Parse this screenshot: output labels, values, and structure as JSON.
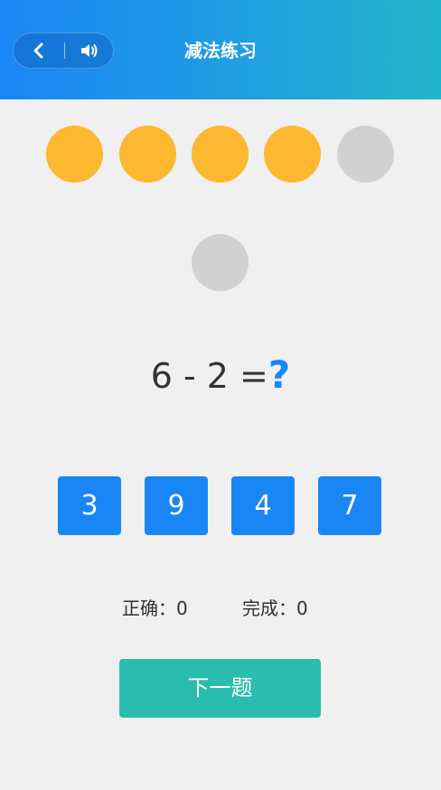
{
  "header": {
    "title": "减法练习",
    "back_icon": "chevron-left-icon",
    "sound_icon": "speaker-icon",
    "gradient": [
      "#1a86f5",
      "#22b5c9"
    ]
  },
  "visual": {
    "dots_total": 5,
    "dots_filled": 4,
    "filled_color": "#fbb830",
    "empty_color": "#d1d1d1"
  },
  "question": {
    "expression": "6 - 2 =",
    "unknown": "?"
  },
  "options": [
    "3",
    "9",
    "4",
    "7"
  ],
  "stats": {
    "correct_label": "正确：",
    "correct_value": "0",
    "done_label": "完成：",
    "done_value": "0"
  },
  "next_button": {
    "label": "下一题",
    "color": "#2bbcb0"
  }
}
